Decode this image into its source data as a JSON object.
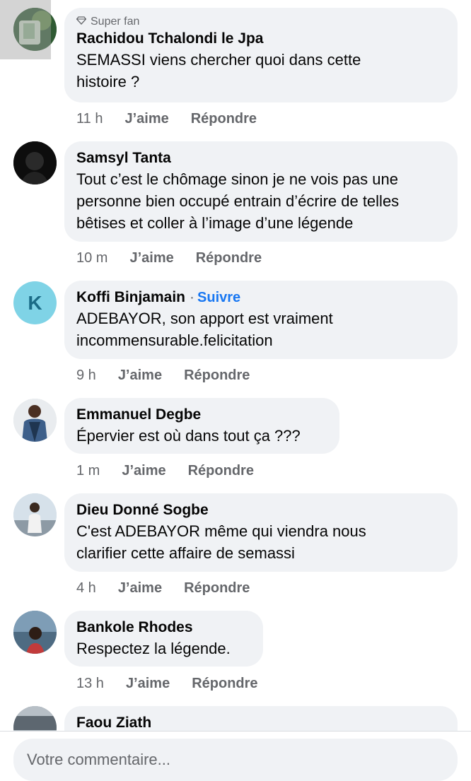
{
  "comments": [
    {
      "badge": "Super fan",
      "author": "Rachidou Tchalondi le Jpa",
      "text": "SEMASSI viens chercher quoi dans cette\nhistoire ?",
      "time": "11 h",
      "like": "J’aime",
      "reply": "Répondre"
    },
    {
      "author": "Samsyl Tanta",
      "text": "Tout c’est le chômage sinon je ne vois pas une\npersonne bien occupé entrain d’écrire de telles\nbêtises et coller à l’image d’une légende",
      "time": "10 m",
      "like": "J’aime",
      "reply": "Répondre"
    },
    {
      "avatar_letter": "K",
      "author": "Koffi Binjamain",
      "separator": "·",
      "follow": "Suivre",
      "text": "ADEBAYOR, son apport est vraiment\nincommensurable.felicitation",
      "time": "9 h",
      "like": "J’aime",
      "reply": "Répondre"
    },
    {
      "author": "Emmanuel Degbe",
      "text": "Épervier est où dans tout ça ???",
      "time": "1 m",
      "like": "J’aime",
      "reply": "Répondre"
    },
    {
      "author": "Dieu Donné Sogbe",
      "text": "C'est ADEBAYOR même qui viendra nous\nclarifier cette affaire de semassi",
      "time": "4 h",
      "like": "J’aime",
      "reply": "Répondre"
    },
    {
      "author": "Bankole Rhodes",
      "text": "Respectez la légende.",
      "time": "13 h",
      "like": "J’aime",
      "reply": "Répondre"
    },
    {
      "author": "Faou Ziath"
    }
  ],
  "composer": {
    "placeholder": "Votre commentaire..."
  },
  "colors": {
    "bubble": "#f0f2f5",
    "meta": "#65676b",
    "follow": "#1877f2",
    "avatar_k": "#7fd3e6"
  }
}
